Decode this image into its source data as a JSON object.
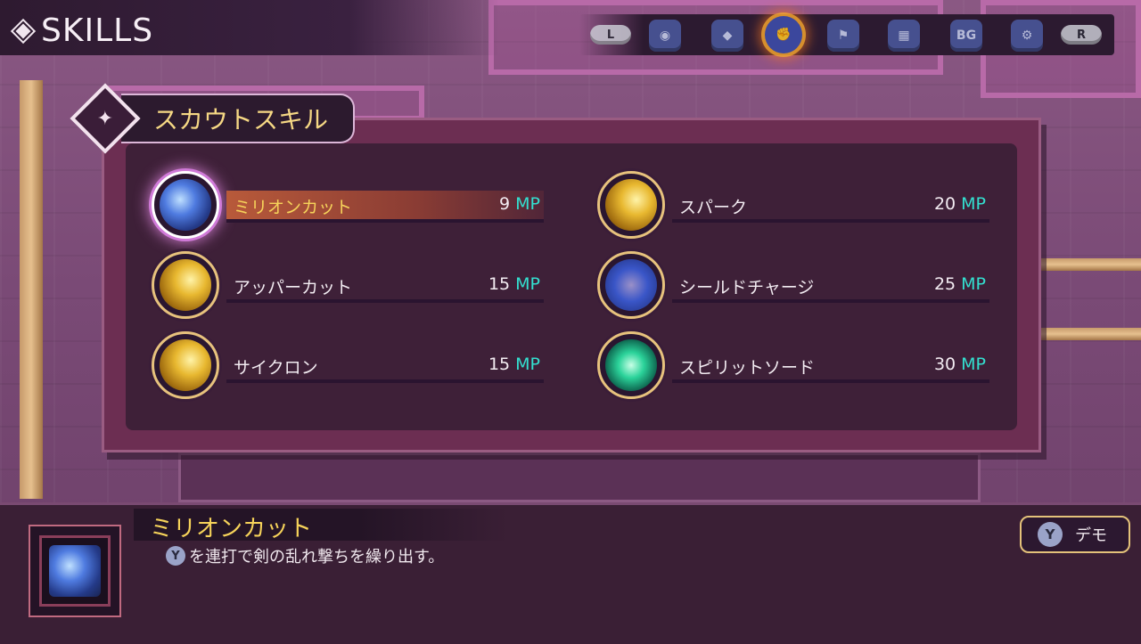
{
  "header": {
    "title": "SKILLS"
  },
  "tabs": [
    {
      "label": "L",
      "icon": "l-shoulder-button-icon",
      "type": "shoulder"
    },
    {
      "label": "",
      "icon": "helmet-icon"
    },
    {
      "label": "",
      "icon": "beast-icon"
    },
    {
      "label": "",
      "icon": "fist-icon",
      "active": true
    },
    {
      "label": "",
      "icon": "flag-icon"
    },
    {
      "label": "",
      "icon": "gear-armor-icon"
    },
    {
      "label": "BG",
      "icon": "bg-icon"
    },
    {
      "label": "",
      "icon": "wrench-icon"
    },
    {
      "label": "R",
      "icon": "r-shoulder-button-icon",
      "type": "shoulder"
    }
  ],
  "category": {
    "label": "スカウトスキル"
  },
  "skills": [
    {
      "name": "ミリオンカット",
      "cost": "9",
      "unit": "MP",
      "icon": "million-cut-icon",
      "selected": true
    },
    {
      "name": "アッパーカット",
      "cost": "15",
      "unit": "MP",
      "icon": "uppercut-icon"
    },
    {
      "name": "サイクロン",
      "cost": "15",
      "unit": "MP",
      "icon": "cyclone-icon"
    },
    {
      "name": "スパーク",
      "cost": "20",
      "unit": "MP",
      "icon": "spark-icon"
    },
    {
      "name": "シールドチャージ",
      "cost": "25",
      "unit": "MP",
      "icon": "shield-charge-icon"
    },
    {
      "name": "スピリットソード",
      "cost": "30",
      "unit": "MP",
      "icon": "spirit-sword-icon"
    }
  ],
  "detail": {
    "title": "ミリオンカット",
    "button_glyph": "Y",
    "description": "を連打で剣の乱れ撃ちを繰り出す。"
  },
  "demo": {
    "button_glyph": "Y",
    "label": "デモ"
  },
  "colors": {
    "accent_gold": "#f6d35a",
    "mp_cyan": "#33e0d0",
    "panel": "#6c2e52"
  }
}
